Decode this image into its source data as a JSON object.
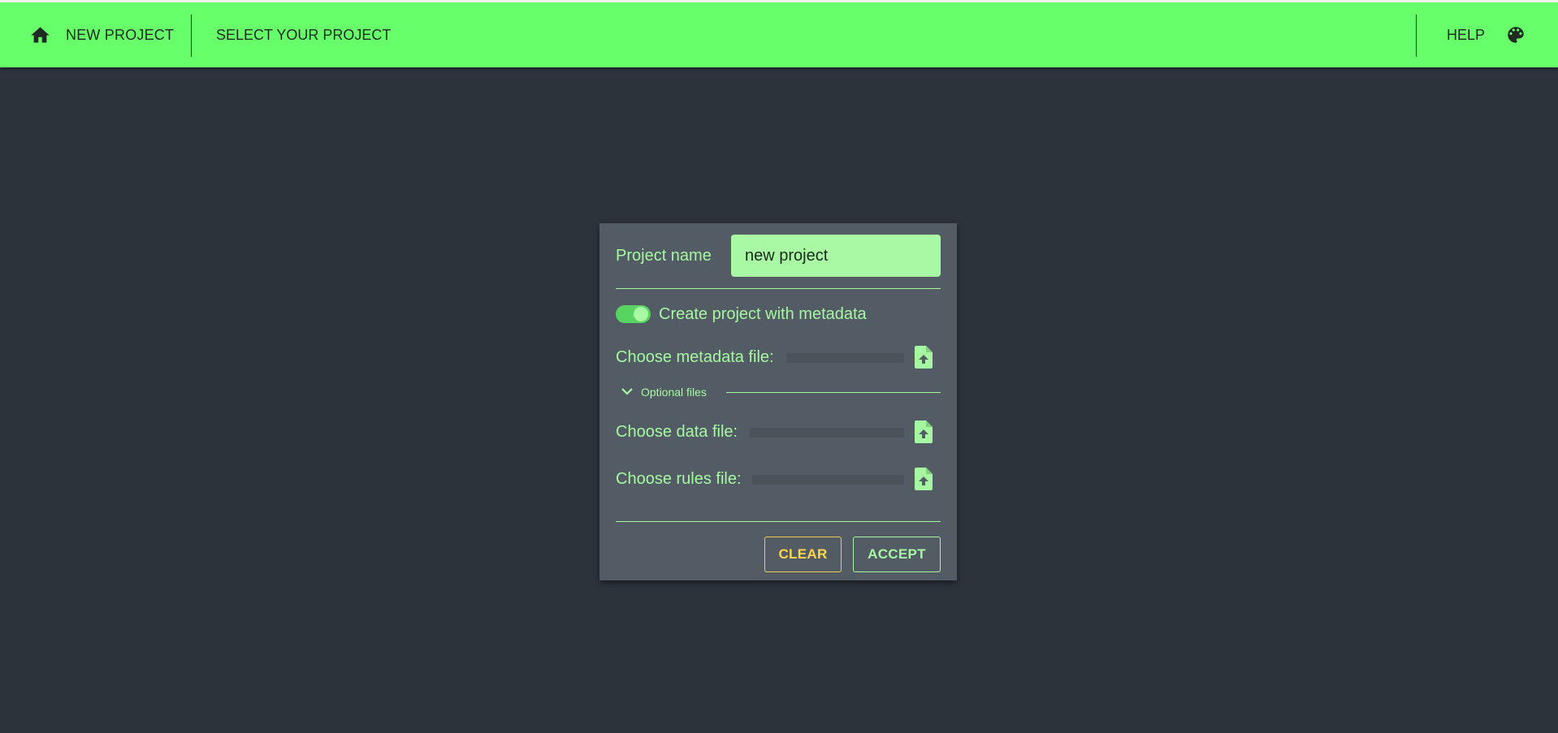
{
  "header": {
    "home_label": "NEW PROJECT",
    "select_project_label": "SELECT YOUR PROJECT",
    "help_label": "HELP",
    "home_icon": "home-icon",
    "palette_icon": "palette-icon",
    "background_color": "#67ff6a"
  },
  "dialog": {
    "project_name_label": "Project name",
    "project_name_value": "new project",
    "metadata_toggle_label": "Create project with metadata",
    "metadata_toggle_on": true,
    "metadata_file_label": "Choose metadata file:",
    "optional_files_label": "Optional files",
    "data_file_label": "Choose data file:",
    "rules_file_label": "Choose rules file:",
    "upload_icon": "file-upload-icon",
    "clear_label": "CLEAR",
    "accept_label": "ACCEPT",
    "accent_color": "#a6f7a2",
    "clear_color": "#ffd74a"
  }
}
